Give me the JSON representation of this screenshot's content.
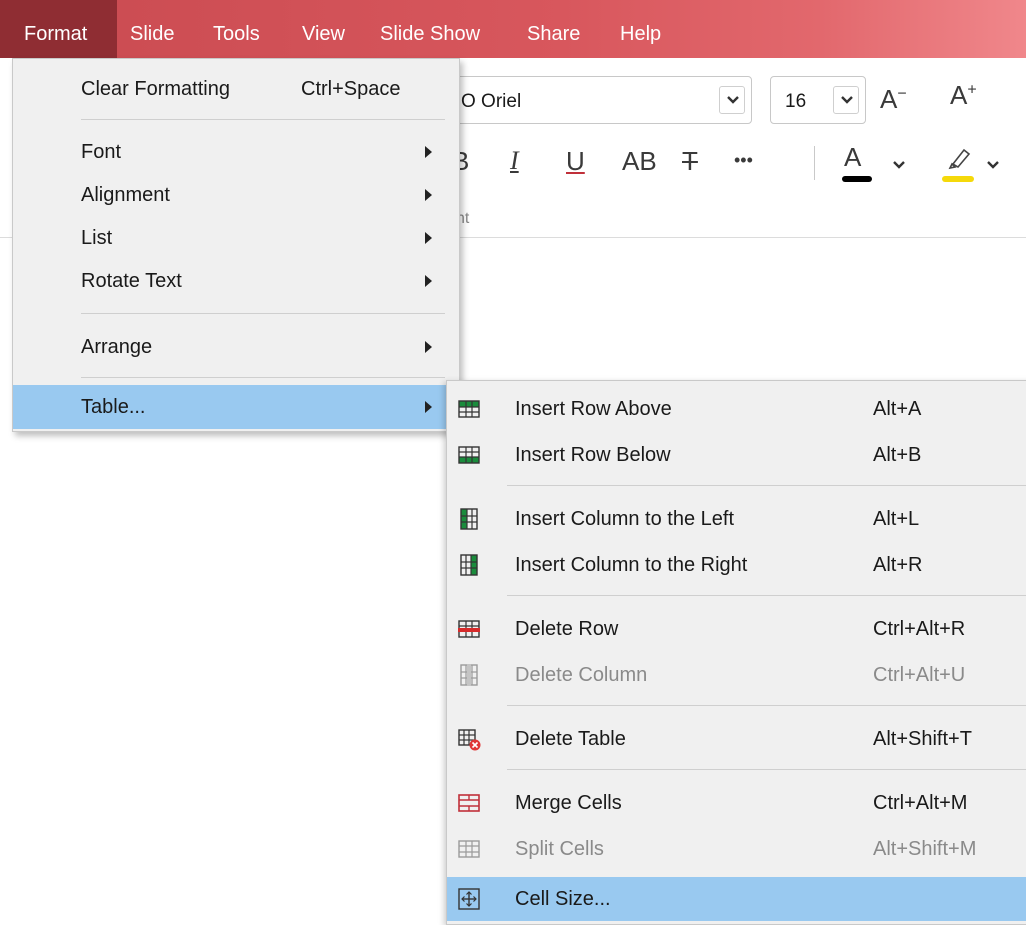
{
  "menubar": {
    "items": [
      "Format",
      "Slide",
      "Tools",
      "View",
      "Slide Show",
      "Share",
      "Help"
    ],
    "active": "Format"
  },
  "toolbar": {
    "font_name": "O Oriel",
    "font_size": "16",
    "grow_font": "A⁺",
    "shrink_font": "A⁻",
    "bold": "B",
    "italic": "I",
    "underline": "U",
    "caps": "AB",
    "strike": "T",
    "more": "•••",
    "group_label": "nt",
    "font_color_hex": "#000000",
    "highlight_hex": "#f5d90a"
  },
  "format_menu": {
    "items": [
      {
        "label": "Clear Formatting",
        "shortcut": "Ctrl+Space"
      },
      {
        "label": "Font",
        "submenu": true
      },
      {
        "label": "Alignment",
        "submenu": true
      },
      {
        "label": "List",
        "submenu": true
      },
      {
        "label": "Rotate Text",
        "submenu": true
      },
      {
        "label": "Arrange",
        "submenu": true
      },
      {
        "label": "Table...",
        "submenu": true,
        "highlighted": true
      }
    ]
  },
  "table_menu": {
    "items": [
      {
        "label": "Insert Row Above",
        "shortcut": "Alt+A",
        "icon": "insert-row-above-icon"
      },
      {
        "label": "Insert Row Below",
        "shortcut": "Alt+B",
        "icon": "insert-row-below-icon"
      },
      {
        "label": "Insert Column to the Left",
        "shortcut": "Alt+L",
        "icon": "insert-column-left-icon"
      },
      {
        "label": "Insert Column to the Right",
        "shortcut": "Alt+R",
        "icon": "insert-column-right-icon"
      },
      {
        "label": "Delete Row",
        "shortcut": "Ctrl+Alt+R",
        "icon": "delete-row-icon"
      },
      {
        "label": "Delete Column",
        "shortcut": "Ctrl+Alt+U",
        "icon": "delete-column-icon",
        "disabled": true
      },
      {
        "label": "Delete Table",
        "shortcut": "Alt+Shift+T",
        "icon": "delete-table-icon"
      },
      {
        "label": "Merge Cells",
        "shortcut": "Ctrl+Alt+M",
        "icon": "merge-cells-icon"
      },
      {
        "label": "Split Cells",
        "shortcut": "Alt+Shift+M",
        "icon": "split-cells-icon",
        "disabled": true
      },
      {
        "label": "Cell Size...",
        "shortcut": "",
        "icon": "cell-size-icon",
        "highlighted": true
      }
    ]
  },
  "colors": {
    "menubar_accent": "#d8575d",
    "menubar_active": "#8f2d33",
    "highlight": "#99c9f0",
    "menu_bg": "#f0f0f0"
  }
}
